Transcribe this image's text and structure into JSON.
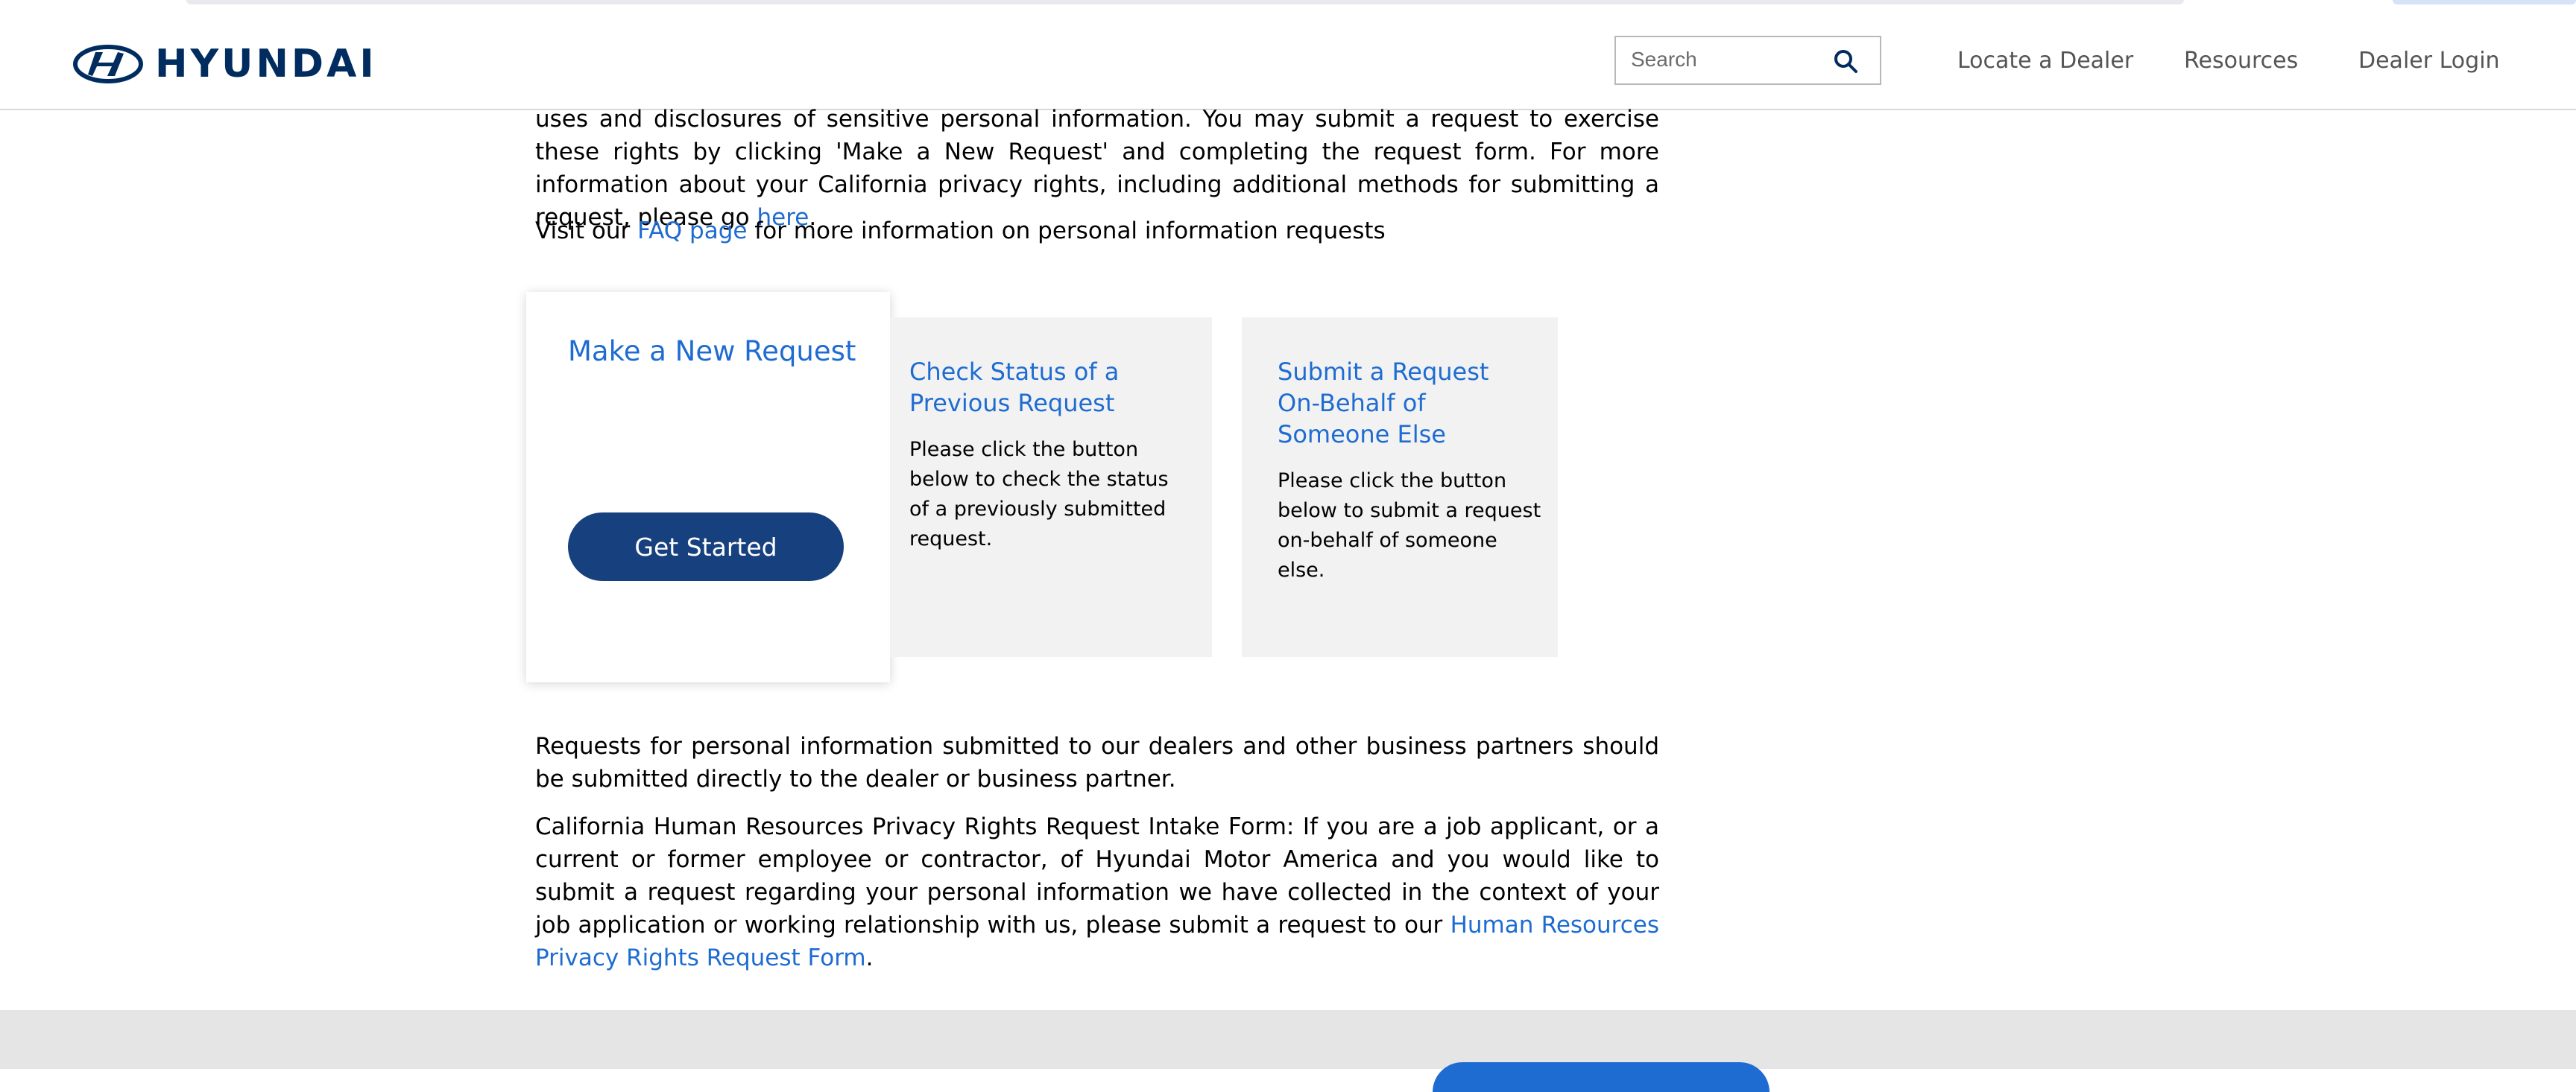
{
  "header": {
    "brand": "HYUNDAI",
    "search_placeholder": "Search",
    "nav": [
      "Locate a Dealer",
      "Resources",
      "Dealer Login"
    ]
  },
  "intro": {
    "line1": "uses and disclosures of sensitive personal information. You may submit a request to exercise these rights by clicking 'Make a New Request' and completing the request form. For more information about your California privacy rights, including additional methods for submitting a request, please go ",
    "here_link": "here",
    "end": "."
  },
  "faq": {
    "prefix": "Visit our ",
    "link": "FAQ page",
    "suffix": " for more information on personal information requests"
  },
  "cards": {
    "new_request": {
      "title": "Make a New Request",
      "button": "Get Started"
    },
    "check_status": {
      "title": "Check Status of a Previous Request",
      "desc": "Please click the button below to check the status of a previously submitted request."
    },
    "on_behalf": {
      "title": "Submit a Request On-Behalf of Someone Else",
      "desc": "Please click the button below to submit a request on-behalf of someone else."
    }
  },
  "dealers_para": "Requests for personal information submitted to our dealers and other business partners should be submitted directly to the dealer or business partner.",
  "hr_para": {
    "text": "California Human Resources Privacy Rights Request Intake Form: If you are a job applicant, or a current or former employee or contractor, of Hyundai Motor America and you would like to submit a request regarding your personal information we have collected in the context of your job application or working relationship with us, please submit a request to our ",
    "link": "Human Resources Privacy Rights Request Form",
    "end": "."
  },
  "colors": {
    "brand_navy": "#002c5f",
    "link_blue": "#1e6cd1",
    "button_navy": "#17407e",
    "card_gray": "#f2f2f2"
  }
}
